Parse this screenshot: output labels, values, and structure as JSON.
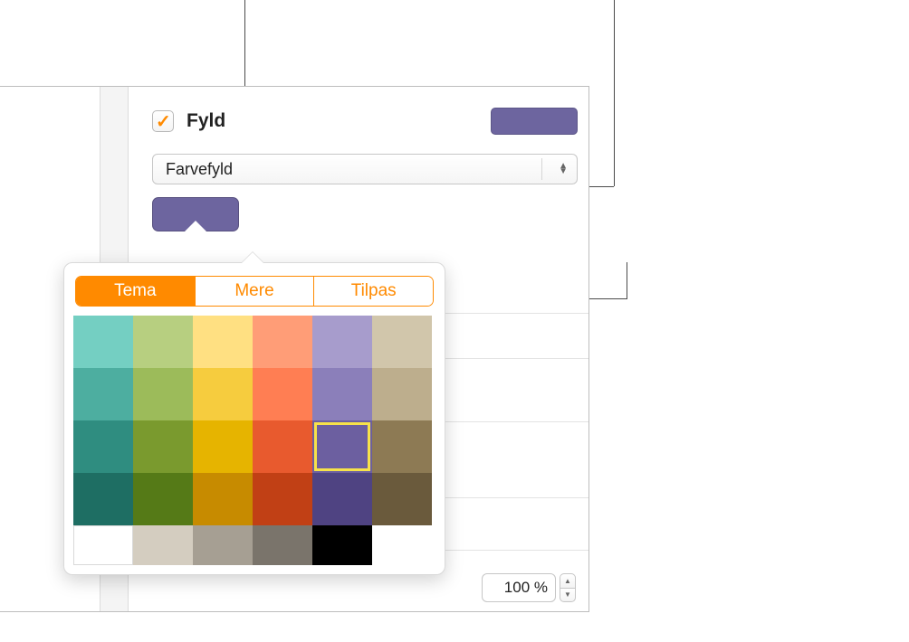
{
  "fill": {
    "checkbox_checked": true,
    "label": "Fyld",
    "swatch_color": "#6d659f"
  },
  "fill_type": {
    "value": "Farvefyld"
  },
  "color_well": {
    "color": "#6d659f"
  },
  "popover": {
    "segments": {
      "tema": "Tema",
      "mere": "Mere",
      "tilpas": "Tilpas",
      "selected": "tema"
    },
    "swatches": [
      [
        "#74cfc2",
        "#b7cf80",
        "#ffe082",
        "#ff9d77",
        "#a79ccc",
        "#d1c6ab"
      ],
      [
        "#4daea0",
        "#9cbb5a",
        "#f6cc3e",
        "#ff7e53",
        "#8b7fba",
        "#bdae8d"
      ],
      [
        "#2f8d80",
        "#7a9a2e",
        "#e6b400",
        "#e85a2e",
        "#6c5fa0",
        "#8d7a54"
      ],
      [
        "#1e6e63",
        "#557a17",
        "#c78b00",
        "#c14015",
        "#4f4382",
        "#6a5a3c"
      ],
      [
        "#ffffff",
        "#d4cdc0",
        "#a69f93",
        "#7a746b",
        "#000000",
        ""
      ]
    ],
    "selected": {
      "row": 2,
      "col": 4
    }
  },
  "opacity": {
    "value": "100 %"
  }
}
